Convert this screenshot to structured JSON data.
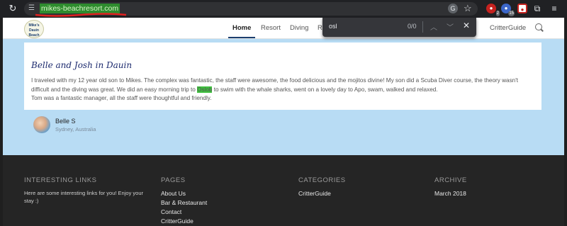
{
  "browser": {
    "url": "mikes-beachresort.com",
    "extensions": [
      {
        "icon": "extension-red-icon",
        "badge": "2"
      },
      {
        "icon": "extension-blue-icon",
        "badge": "15"
      },
      {
        "icon": "extension-record-icon"
      },
      {
        "icon": "puzzle-icon"
      },
      {
        "icon": "menu-icon"
      }
    ]
  },
  "findbar": {
    "query": "osl",
    "count": "0/0"
  },
  "nav": {
    "logo_text": "Mike's Dauin Beach Resort",
    "items": [
      "Home",
      "Resort",
      "Diving",
      "R",
      "CritterGuide"
    ]
  },
  "review": {
    "title": "Belle and Josh in Dauin",
    "line1": "I traveled with my 12 year old son to Mikes. The complex was fantastic, the staff were awesome, the food delicious and the mojitos divine! My son did a Scuba Diver course, the theory wasn't",
    "line2_pre": "difficult and the diving was great. We did an easy morning trip to ",
    "line2_highlight": "Oslob",
    "line2_post": " to swim with the whale sharks, went on a lovely day to Apo, swam, walked and relaxed.",
    "line3": "Tom was a fantastic manager, all the staff were thoughtful and friendly.",
    "author": "Belle S",
    "location": "Sydney, Australia"
  },
  "footer": {
    "interesting": {
      "heading": "INTERESTING LINKS",
      "text": "Here are some interesting links for you! Enjoy your stay :)"
    },
    "pages": {
      "heading": "PAGES",
      "links": [
        "About Us",
        "Bar & Restaurant",
        "Contact",
        "CritterGuide"
      ]
    },
    "categories": {
      "heading": "CATEGORIES",
      "links": [
        "CritterGuide"
      ]
    },
    "archive": {
      "heading": "ARCHIVE",
      "links": [
        "March 2018"
      ]
    }
  },
  "colors": {
    "accent": "#1c3f6e",
    "highlight": "#3ec13e",
    "page_bg": "#b8dcf4"
  }
}
